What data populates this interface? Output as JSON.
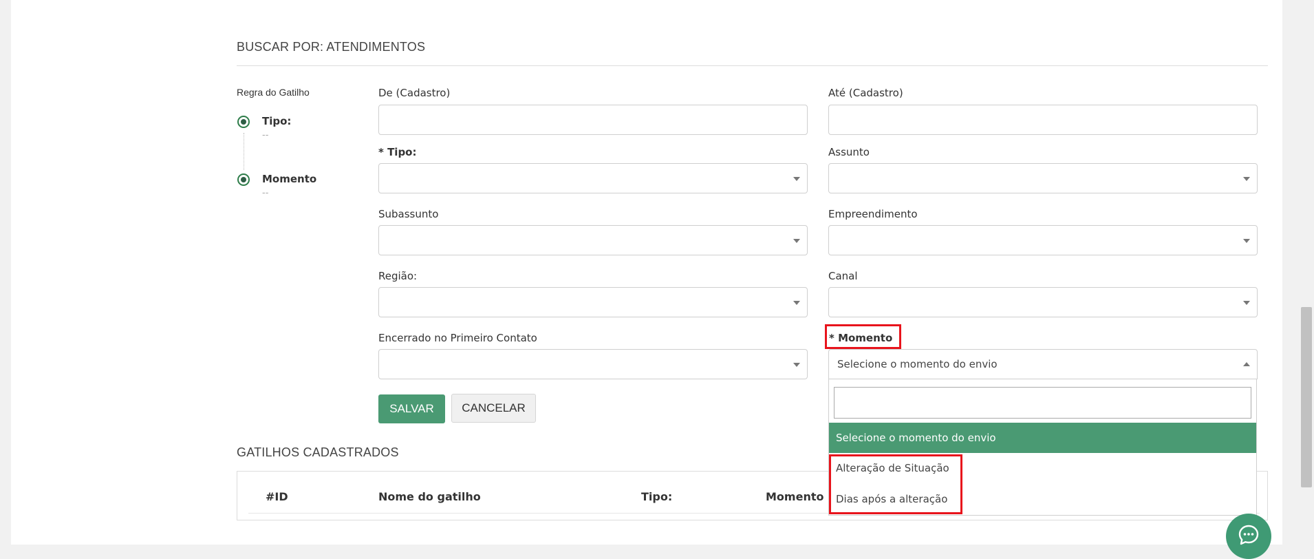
{
  "section_search": {
    "title": "BUSCAR POR: ATENDIMENTOS"
  },
  "steps": {
    "title": "Regra do Gatilho",
    "items": [
      {
        "label": "Tipo:",
        "value": "--"
      },
      {
        "label": "Momento",
        "value": "--"
      }
    ]
  },
  "form": {
    "de_cadastro": {
      "label": "De (Cadastro)",
      "value": ""
    },
    "ate_cadastro": {
      "label": "Até (Cadastro)",
      "value": ""
    },
    "tipo": {
      "label": "* Tipo:",
      "value": ""
    },
    "assunto": {
      "label": "Assunto",
      "value": ""
    },
    "subassunto": {
      "label": "Subassunto",
      "value": ""
    },
    "empreendimento": {
      "label": "Empreendimento",
      "value": ""
    },
    "regiao": {
      "label": "Região:",
      "value": ""
    },
    "canal": {
      "label": "Canal",
      "value": ""
    },
    "encerrado": {
      "label": "Encerrado no Primeiro Contato",
      "value": ""
    },
    "momento": {
      "label": "* Momento",
      "value": "Selecione o momento do envio",
      "search_value": "",
      "options": [
        "Selecione o momento do envio",
        "Alteração de Situação",
        "Dias após a alteração"
      ],
      "selected_option": "Selecione o momento do envio"
    }
  },
  "buttons": {
    "save": "SALVAR",
    "cancel": "CANCELAR"
  },
  "section_triggers": {
    "title": "GATILHOS CADASTRADOS",
    "columns": [
      "#ID",
      "Nome do gatilho",
      "Tipo:",
      "Momento"
    ]
  },
  "colors": {
    "accent": "#4a9a73",
    "highlight": "#e8141c",
    "step_dot": "#2e5e45"
  },
  "icons": {
    "chat": "chat-bubble-icon",
    "dropdown": "chevron-down-icon",
    "dropdown_open": "chevron-up-icon"
  }
}
